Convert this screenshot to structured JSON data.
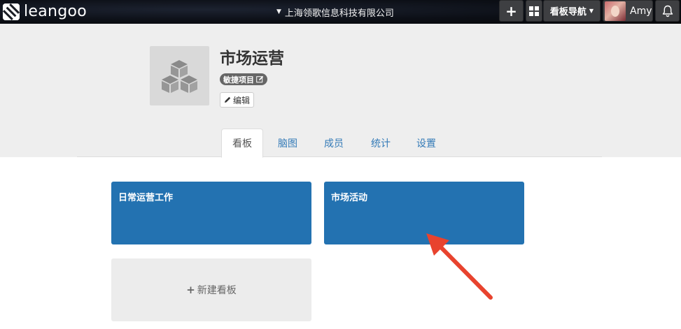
{
  "topbar": {
    "brand": "leangoo",
    "organization": "上海领歌信息科技有限公司",
    "add_label": "+",
    "board_nav_label": "看板导航",
    "user_name": "Amy",
    "icons": [
      "leangoo-logo-icon",
      "caret-down-icon",
      "plus-icon",
      "grid-icon",
      "caret-down-icon",
      "avatar",
      "bell-icon"
    ]
  },
  "project": {
    "title": "市场运营",
    "badge": "敏捷项目",
    "edit_label": "编辑"
  },
  "tabs": [
    {
      "label": "看板",
      "active": true
    },
    {
      "label": "脑图",
      "active": false
    },
    {
      "label": "成员",
      "active": false
    },
    {
      "label": "统计",
      "active": false
    },
    {
      "label": "设置",
      "active": false
    }
  ],
  "boards": [
    {
      "title": "日常运营工作"
    },
    {
      "title": "市场活动"
    }
  ],
  "new_board_label": "新建看板",
  "colors": {
    "topbar_bg": "#0c0f16",
    "header_bg": "#eeeeee",
    "board_blue": "#2372b1",
    "link_blue": "#337ab7",
    "annotation_red": "#e8432e"
  }
}
